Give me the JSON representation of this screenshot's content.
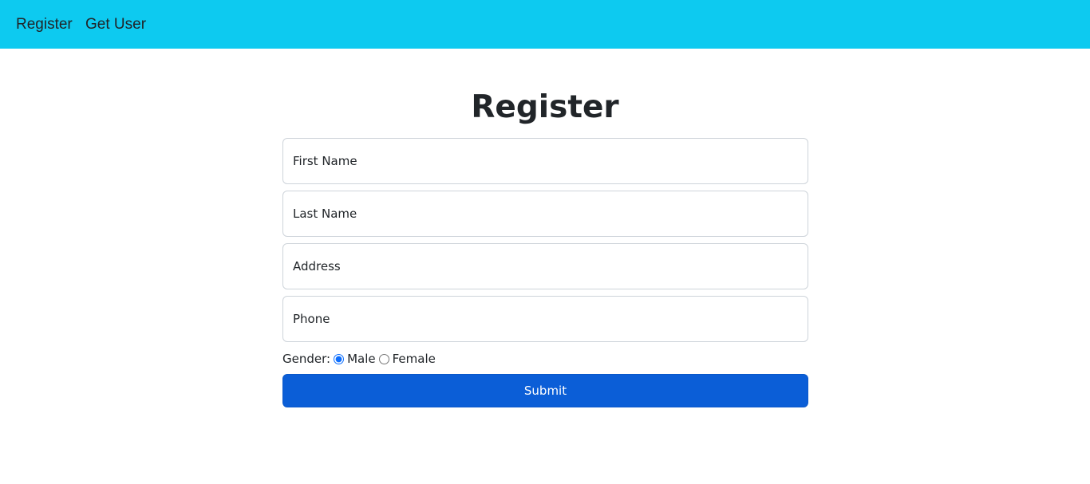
{
  "nav": {
    "items": [
      {
        "label": "Register"
      },
      {
        "label": "Get User"
      }
    ],
    "bg_color": "#0dcaf0"
  },
  "form": {
    "title": "Register",
    "fields": [
      {
        "placeholder": "First Name",
        "value": ""
      },
      {
        "placeholder": "Last Name",
        "value": ""
      },
      {
        "placeholder": "Address",
        "value": ""
      },
      {
        "placeholder": "Phone",
        "value": ""
      }
    ],
    "gender": {
      "label": "Gender:",
      "options": [
        {
          "label": "Male",
          "selected": true
        },
        {
          "label": "Female",
          "selected": false
        }
      ]
    },
    "submit_label": "Submit",
    "submit_color": "#0b5ed7"
  }
}
